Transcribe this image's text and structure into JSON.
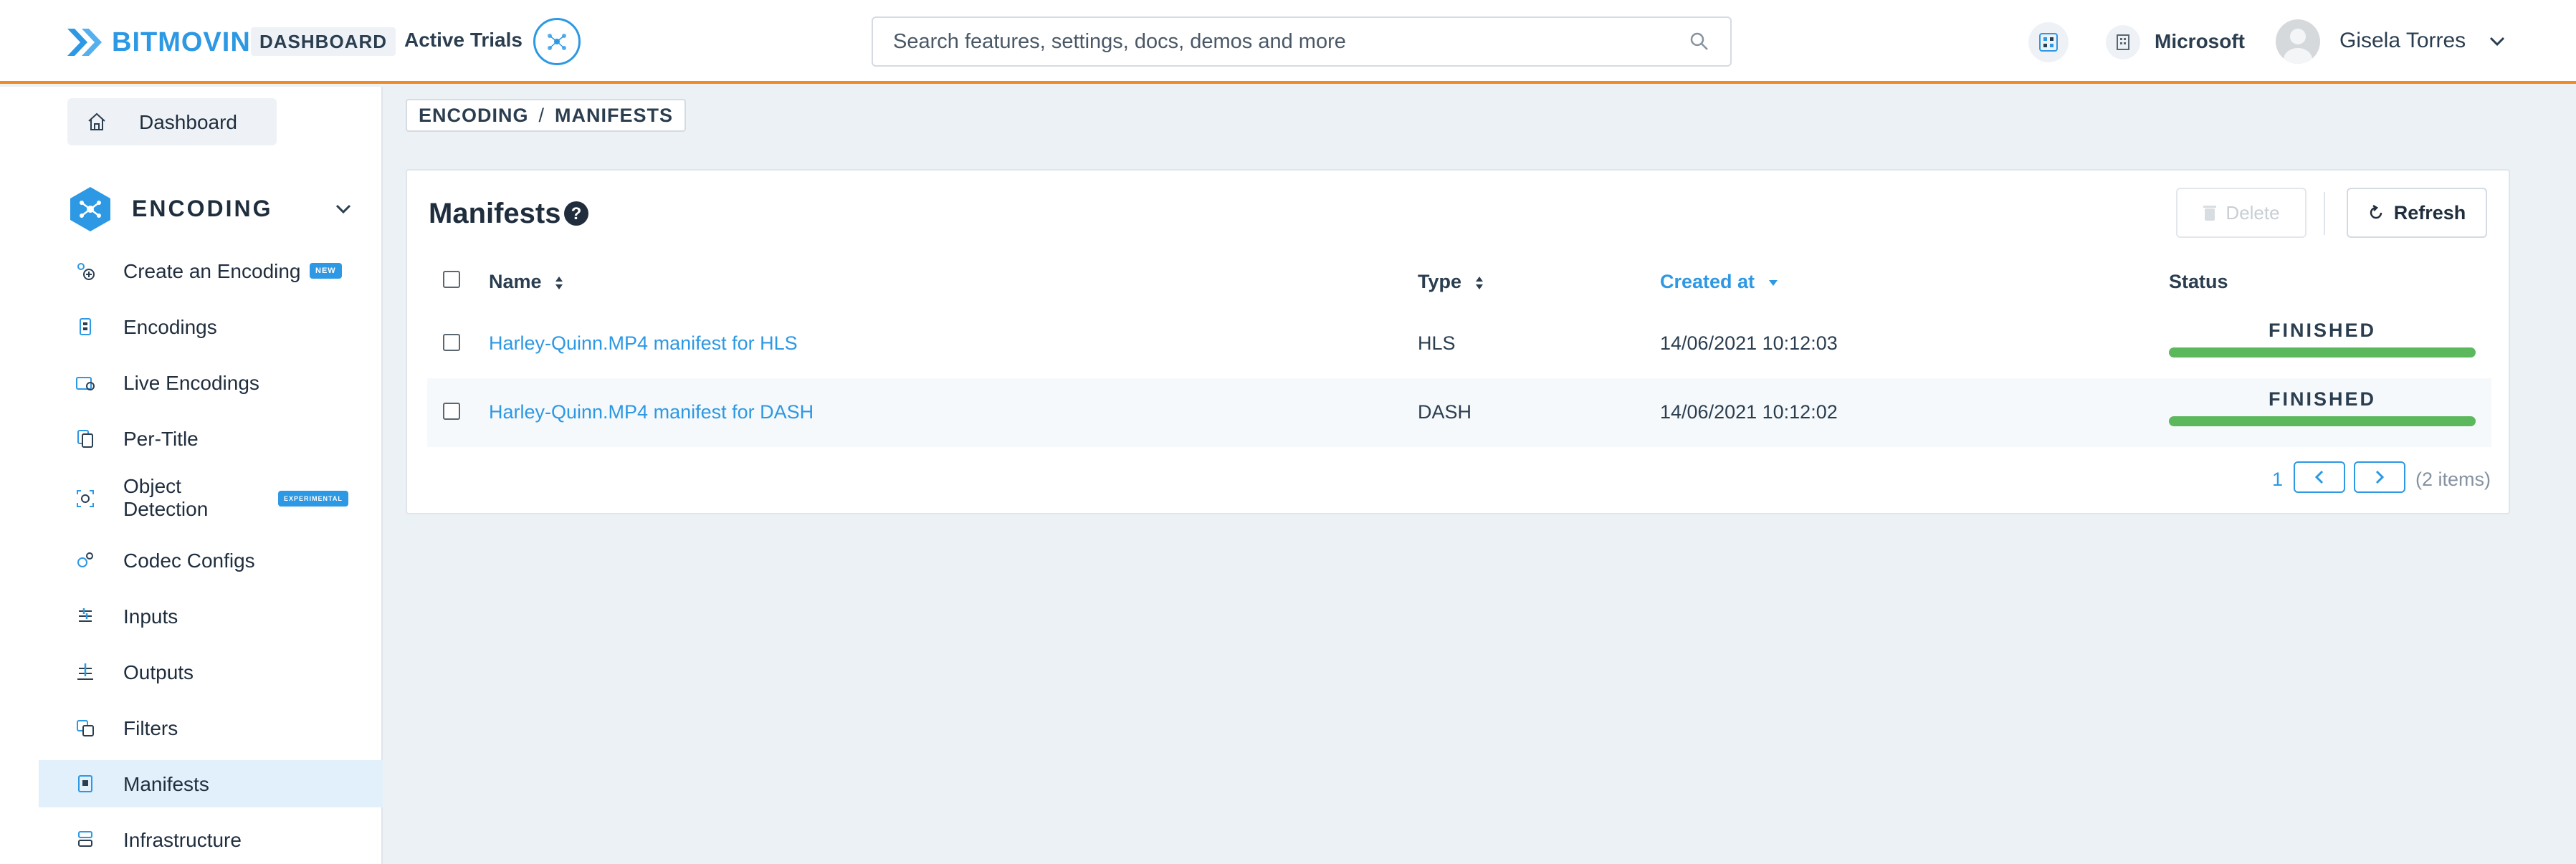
{
  "header": {
    "logo_text": "BITMOVIN",
    "dashboard_badge": "DASHBOARD",
    "active_trials": "Active Trials",
    "search_placeholder": "Search features, settings, docs, demos and more",
    "org_name": "Microsoft",
    "user_name": "Gisela Torres",
    "accent_color": "#f08a24",
    "brand_color": "#2d98e3"
  },
  "sidebar": {
    "dashboard_label": "Dashboard",
    "section_title": "ENCODING",
    "items": [
      {
        "label": "Create an Encoding",
        "badge": "NEW",
        "icon": "create-encoding-icon"
      },
      {
        "label": "Encodings",
        "icon": "encodings-icon"
      },
      {
        "label": "Live Encodings",
        "icon": "live-encodings-icon"
      },
      {
        "label": "Per-Title",
        "icon": "per-title-icon"
      },
      {
        "label_line1": "Object",
        "label_line2": "Detection",
        "badge": "EXPERIMENTAL",
        "icon": "object-detection-icon"
      },
      {
        "label": "Codec Configs",
        "icon": "codec-configs-icon"
      },
      {
        "label": "Inputs",
        "icon": "inputs-icon"
      },
      {
        "label": "Outputs",
        "icon": "outputs-icon"
      },
      {
        "label": "Filters",
        "icon": "filters-icon"
      },
      {
        "label": "Manifests",
        "icon": "manifests-icon",
        "active": true
      },
      {
        "label": "Infrastructure",
        "icon": "infrastructure-icon"
      }
    ]
  },
  "breadcrumb": {
    "parent": "ENCODING",
    "separator": "/",
    "current": "MANIFESTS"
  },
  "main": {
    "title": "Manifests",
    "delete_label": "Delete",
    "refresh_label": "Refresh",
    "columns": {
      "name": "Name",
      "type": "Type",
      "created_at": "Created at",
      "status": "Status"
    },
    "rows": [
      {
        "name": "Harley-Quinn.MP4 manifest for HLS",
        "type": "HLS",
        "created_at": "14/06/2021 10:12:03",
        "status": "FINISHED",
        "progress": 1.0
      },
      {
        "name": "Harley-Quinn.MP4 manifest for DASH",
        "type": "DASH",
        "created_at": "14/06/2021 10:12:02",
        "status": "FINISHED",
        "progress": 1.0
      }
    ],
    "pagination": {
      "current_page": "1",
      "count_text": "(2 items)"
    },
    "status_color": "#5cb85c"
  }
}
